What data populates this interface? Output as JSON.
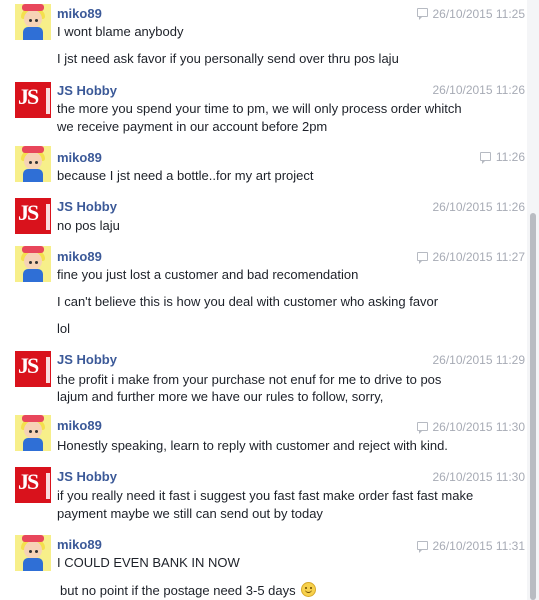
{
  "messages": [
    {
      "sender": "miko89",
      "time": "26/10/2015 11:25",
      "lines": [
        "I wont blame anybody",
        "I jst need ask favor if you personally send over thru pos laju"
      ]
    },
    {
      "sender": "JS Hobby",
      "time": "26/10/2015 11:26",
      "lines": [
        "the more you spend your time to pm, we will only process order whitch",
        "we receive payment in our account before 2pm"
      ]
    },
    {
      "sender": "miko89",
      "time": "11:26",
      "lines": [
        "because I jst need a bottle..for my art project"
      ]
    },
    {
      "sender": "JS Hobby",
      "time": "26/10/2015 11:26",
      "lines": [
        "no pos laju"
      ]
    },
    {
      "sender": "miko89",
      "time": "26/10/2015 11:27",
      "lines": [
        "fine you just lost a customer and bad recomendation",
        "I can't believe this is how you deal with customer who asking favor",
        "lol"
      ]
    },
    {
      "sender": "JS Hobby",
      "time": "26/10/2015 11:29",
      "lines": [
        "the profit i make from your purchase not enuf for me to drive to pos",
        "lajum and further more we have our rules to follow, sorry,"
      ]
    },
    {
      "sender": "miko89",
      "time": "26/10/2015 11:30",
      "lines": [
        "Honestly speaking, learn to reply with customer and reject with kind."
      ]
    },
    {
      "sender": "JS Hobby",
      "time": "26/10/2015 11:30",
      "lines": [
        "if you really need it fast i suggest you fast fast make order fast fast make",
        "payment maybe we still can send out by today"
      ]
    },
    {
      "sender": "miko89",
      "time": "26/10/2015 11:31",
      "lines": [
        "I COULD EVEN BANK IN NOW",
        "but no point if the postage need 3-5 days"
      ]
    }
  ],
  "avatar_labels": {
    "js": "JS",
    "js_side": "HOBBY"
  },
  "colors": {
    "name": "#3b5998",
    "time": "#a7abb5",
    "js_avatar": "#d9121c",
    "miko_avatar": "#f7ef8a"
  }
}
